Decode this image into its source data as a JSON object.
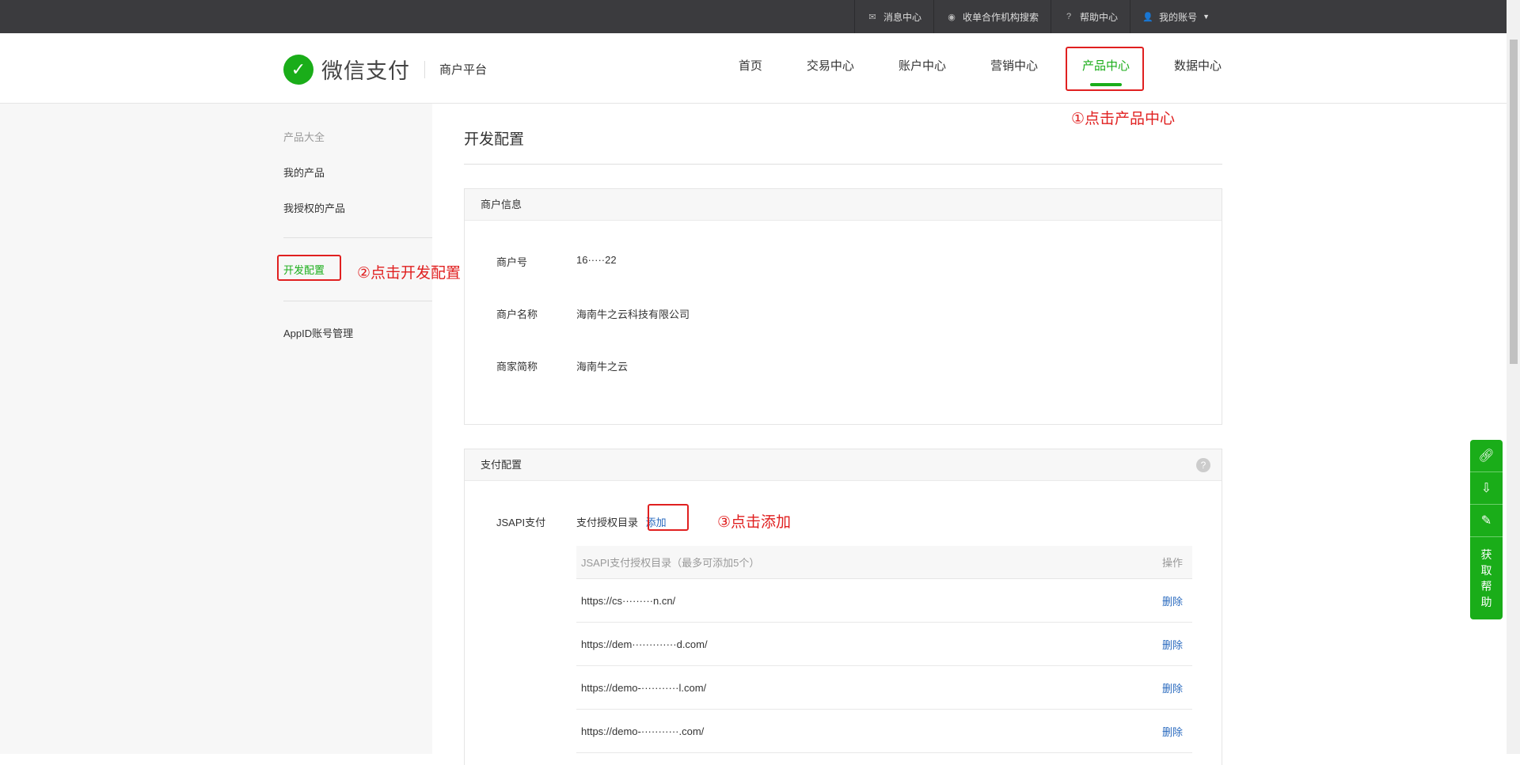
{
  "topbar": {
    "items": [
      {
        "icon": "mail-icon",
        "label": "消息中心"
      },
      {
        "icon": "search-circle-icon",
        "label": "收单合作机构搜索"
      },
      {
        "icon": "help-icon",
        "label": "帮助中心"
      },
      {
        "icon": "user-icon",
        "label": "我的账号"
      }
    ]
  },
  "header": {
    "logo": "微信支付",
    "sub": "商户平台",
    "nav": [
      "首页",
      "交易中心",
      "账户中心",
      "营销中心",
      "产品中心",
      "数据中心"
    ],
    "active": "产品中心"
  },
  "annotations": {
    "a1": "①点击产品中心",
    "a2": "②点击开发配置",
    "a3": "③点击添加"
  },
  "sidebar": {
    "section": "产品大全",
    "items": [
      "我的产品",
      "我授权的产品",
      "开发配置",
      "AppID账号管理"
    ]
  },
  "main": {
    "title": "开发配置",
    "merchant": {
      "title": "商户信息",
      "rows": [
        {
          "label": "商户号",
          "value": "16·····22"
        },
        {
          "label": "商户名称",
          "value": "海南牛之云科技有限公司"
        },
        {
          "label": "商家简称",
          "value": "海南牛之云"
        }
      ]
    },
    "pay": {
      "title": "支付配置",
      "jsapi_label": "JSAPI支付",
      "dir_label": "支付授权目录",
      "add": "添加",
      "table_header": "JSAPI支付授权目录（最多可添加5个）",
      "op_header": "操作",
      "rows": [
        {
          "url": "https://cs·········n.cn/",
          "action": "删除"
        },
        {
          "url": "https://dem·············d.com/",
          "action": "删除"
        },
        {
          "url": "https://demo-···········l.com/",
          "action": "删除"
        },
        {
          "url": "https://demo-···········.com/",
          "action": "删除"
        }
      ]
    }
  },
  "float": {
    "help": "获取帮助"
  },
  "colors": {
    "brand": "#1aad19",
    "annotation": "#e02020",
    "link": "#2b6bbf"
  }
}
